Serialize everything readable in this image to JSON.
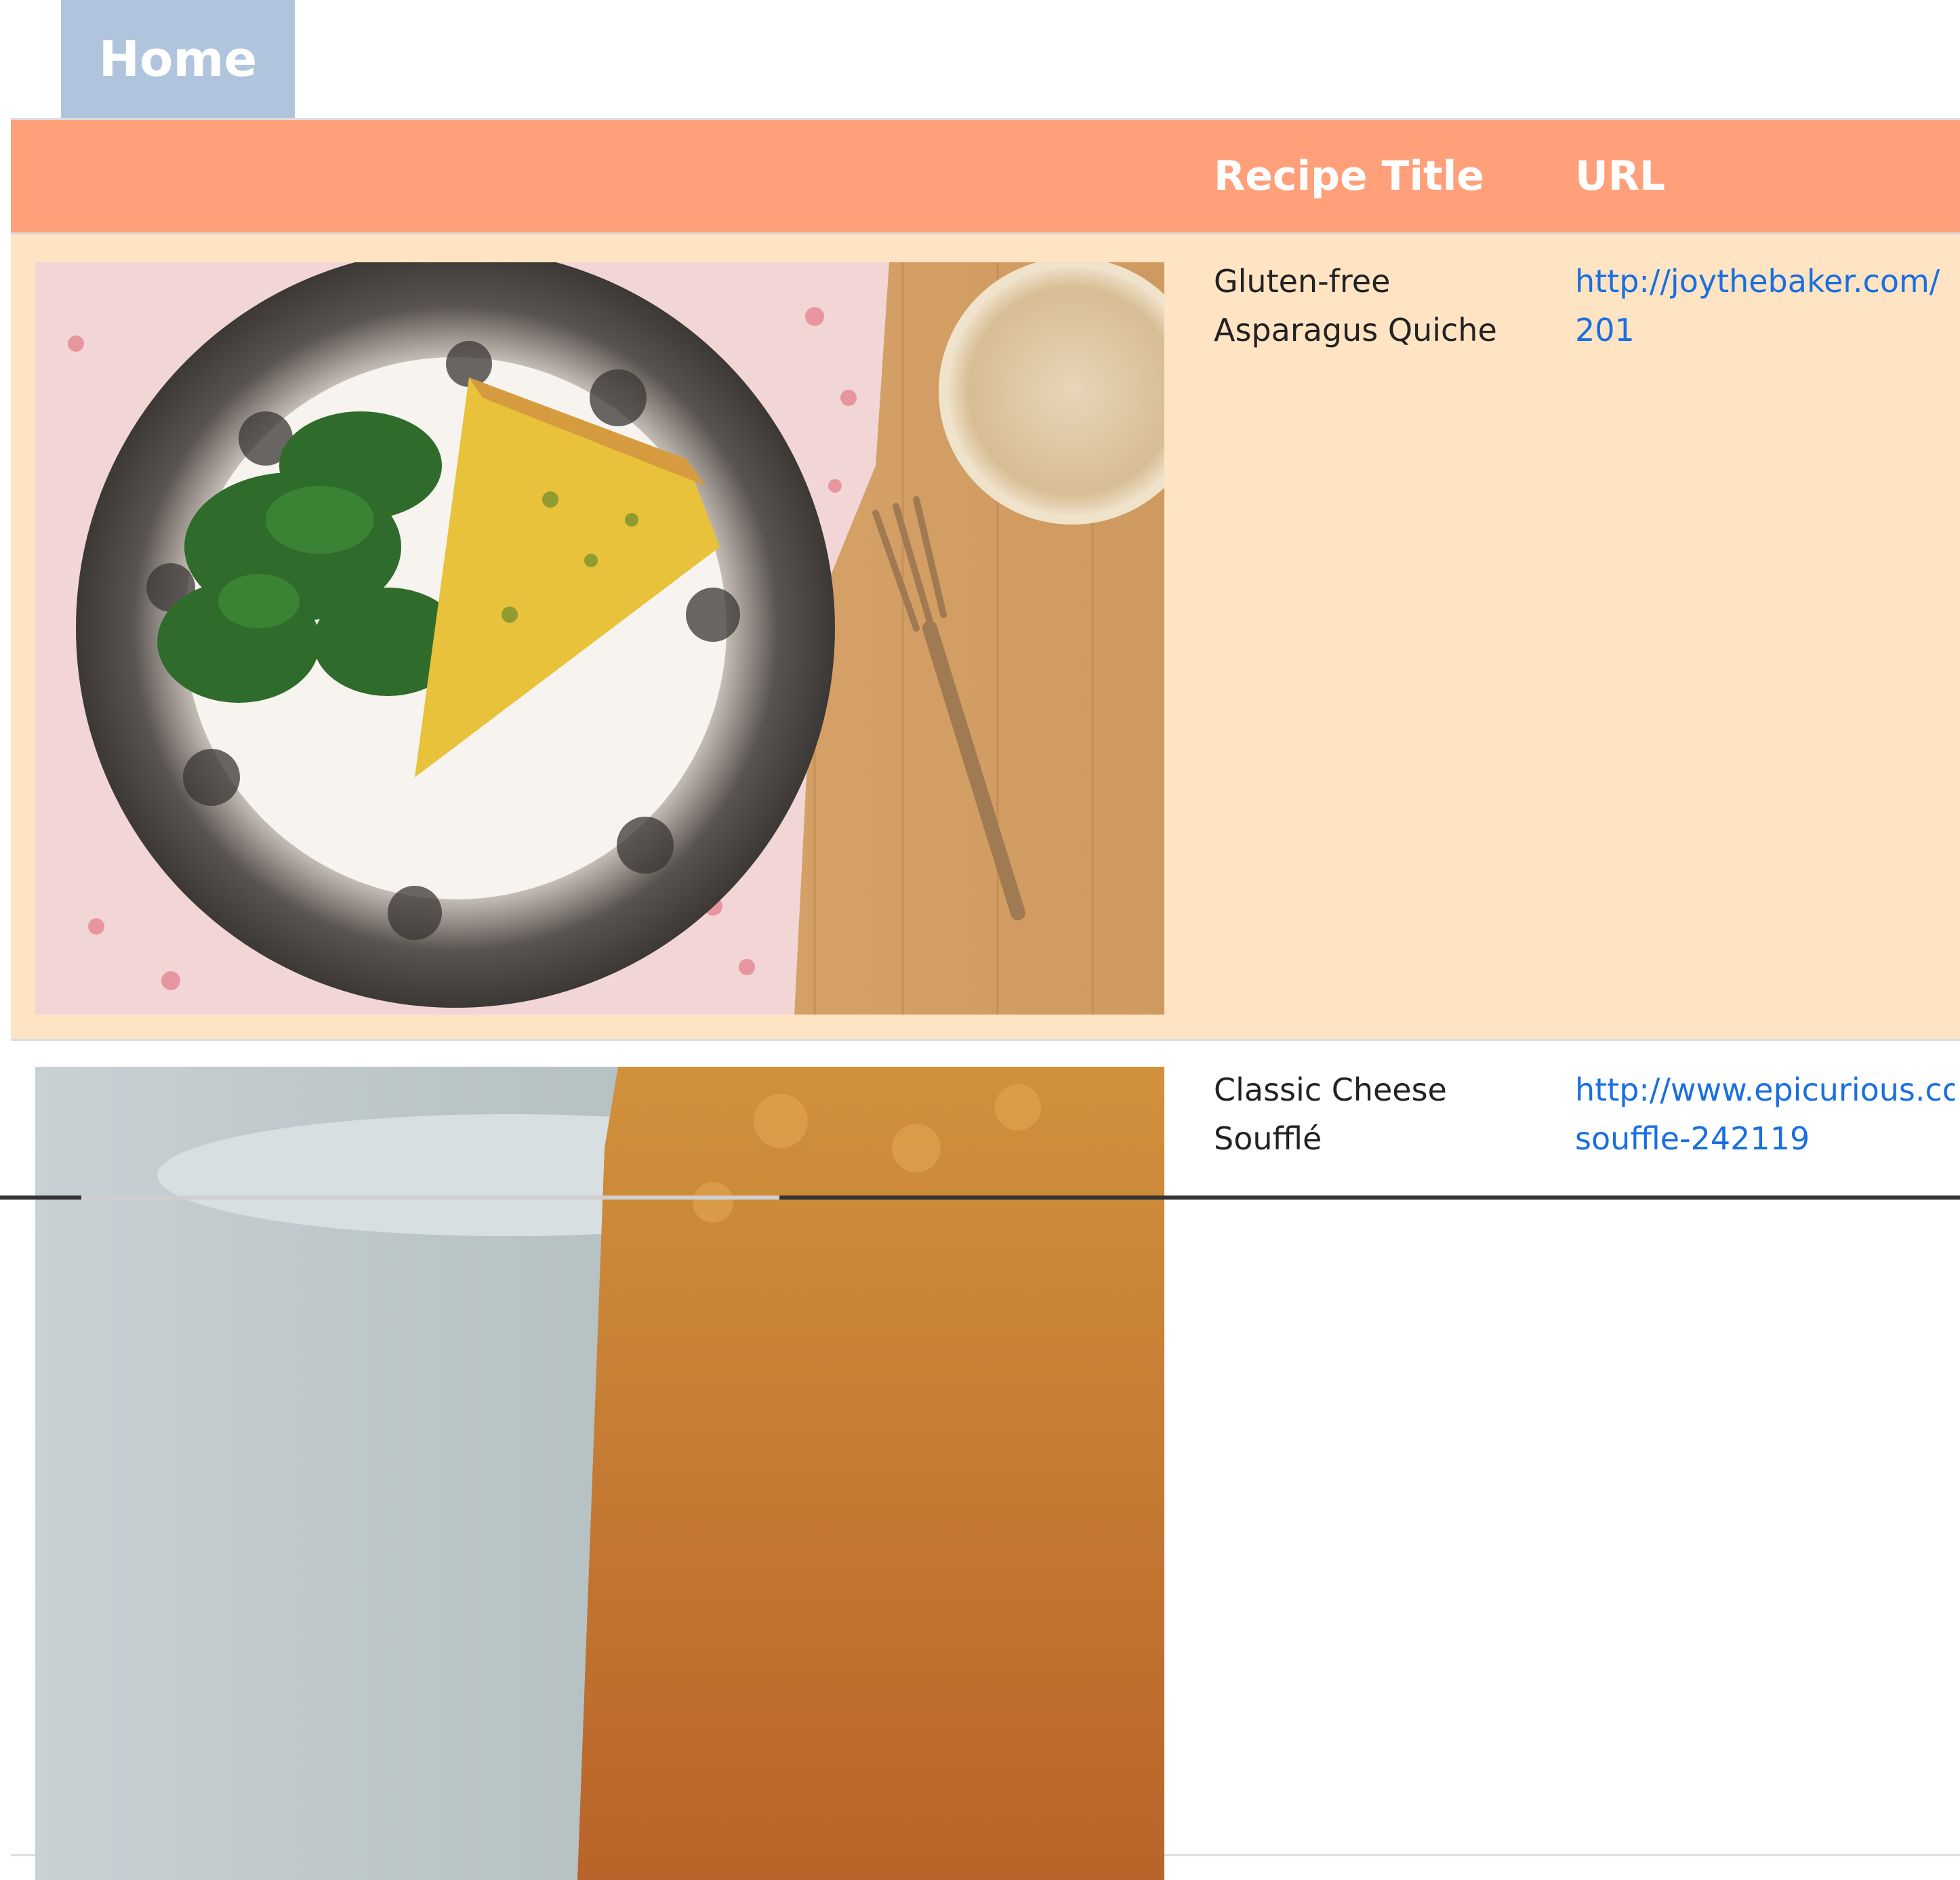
{
  "nav": {
    "home_label": "Home"
  },
  "table": {
    "headers": {
      "image": "",
      "title": "Recipe Title",
      "url": "URL"
    },
    "rows": [
      {
        "title_line1": "Gluten-free",
        "title_line2": "Asparagus Quiche",
        "url_line1": "http://joythebaker.com/201",
        "url_line2": ""
      },
      {
        "title_line1": "Classic Cheese",
        "title_line2": "Soufflé",
        "url_line1": "http://www.epicurious.com",
        "url_line2": "souffle-242119"
      }
    ]
  },
  "colors": {
    "home_tab": "#b0c4de",
    "header_bg": "#ffa07a",
    "row_highlight": "#ffe4c4",
    "link": "#1a6fe0"
  }
}
